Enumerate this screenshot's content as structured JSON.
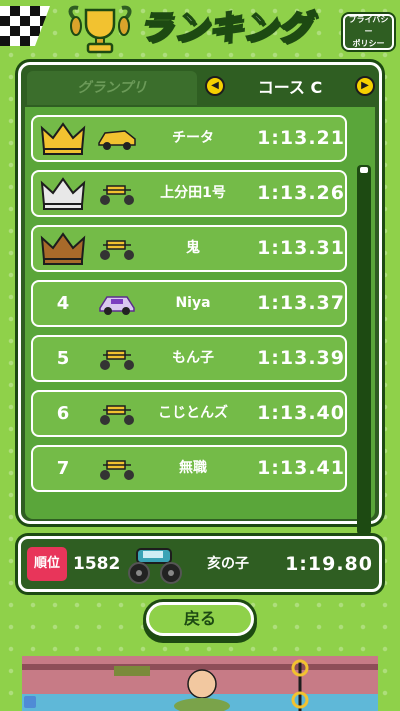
{
  "header": {
    "title": "ランキング",
    "privacy_line1": "プライバシー",
    "privacy_line2": "ポリシー"
  },
  "tabs": {
    "grand": "グランプリ",
    "course": "コース C"
  },
  "rows": [
    {
      "rank": "",
      "medal": "gold",
      "car": "yellow-car",
      "name": "チータ",
      "time": "1:13.21"
    },
    {
      "rank": "",
      "medal": "silver",
      "car": "buggy",
      "name": "上分田1号",
      "time": "1:13.26"
    },
    {
      "rank": "",
      "medal": "bronze",
      "car": "buggy",
      "name": "鬼",
      "time": "1:13.31"
    },
    {
      "rank": "4",
      "medal": "",
      "car": "purple-car",
      "name": "Niya",
      "time": "1:13.37"
    },
    {
      "rank": "5",
      "medal": "",
      "car": "buggy",
      "name": "もん子",
      "time": "1:13.39"
    },
    {
      "rank": "6",
      "medal": "",
      "car": "buggy",
      "name": "こじとんズ",
      "time": "1:13.40"
    },
    {
      "rank": "7",
      "medal": "",
      "car": "buggy",
      "name": "無職",
      "time": "1:13.41"
    }
  ],
  "my_record": {
    "badge": "順位",
    "rank": "1582",
    "name": "亥の子",
    "time": "1:19.80",
    "car": "monster-truck"
  },
  "back_label": "戻る",
  "colors": {
    "background": "#8fd14a",
    "panel": "#2f5e22",
    "row": "#74bb48",
    "badge": "#e8355a"
  }
}
